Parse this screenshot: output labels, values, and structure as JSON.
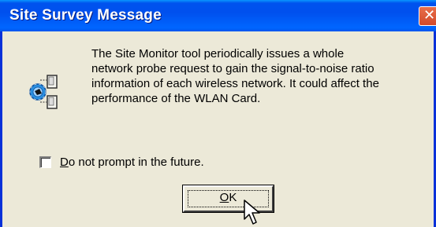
{
  "dialog": {
    "title": "Site Survey Message",
    "close_label": "✕"
  },
  "message": {
    "lines": [
      "The Site Monitor tool periodically issues a whole",
      "network probe request to gain the signal-to-noise ratio",
      "information of each wireless network. It could affect the",
      "performance of the WLAN Card."
    ]
  },
  "checkbox": {
    "mnemonic": "D",
    "label_rest": "o not prompt in the future.",
    "checked": false
  },
  "ok_button": {
    "mnemonic": "O",
    "label_rest": "K"
  },
  "icons": {
    "message_icon": "network-probe-icon",
    "cursor": "mouse-pointer-icon"
  },
  "colors": {
    "titlebar": "#0055EE",
    "window_face": "#ECE9D8",
    "close_button": "#D24A2B"
  }
}
